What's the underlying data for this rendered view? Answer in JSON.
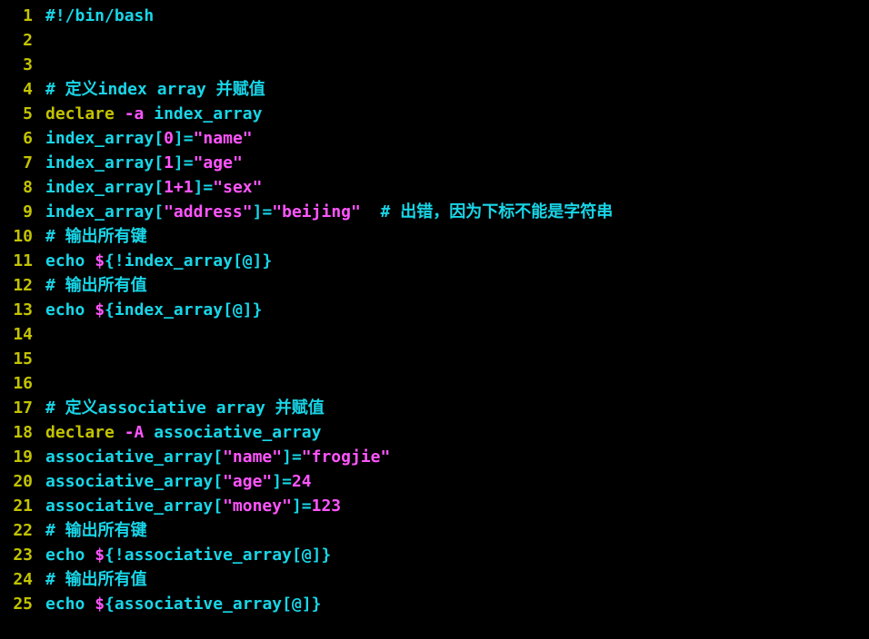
{
  "lines": [
    {
      "n": "1",
      "tokens": [
        {
          "t": "#!/bin/bash",
          "c": "c-comment"
        }
      ]
    },
    {
      "n": "2",
      "tokens": []
    },
    {
      "n": "3",
      "tokens": []
    },
    {
      "n": "4",
      "tokens": [
        {
          "t": "# 定义index array 并赋值",
          "c": "c-comment"
        }
      ]
    },
    {
      "n": "5",
      "tokens": [
        {
          "t": "declare",
          "c": "c-keyword"
        },
        {
          "t": " ",
          "c": "c-plain"
        },
        {
          "t": "-a",
          "c": "c-flag"
        },
        {
          "t": " ",
          "c": "c-plain"
        },
        {
          "t": "index_array",
          "c": "c-ident"
        }
      ]
    },
    {
      "n": "6",
      "tokens": [
        {
          "t": "index_array",
          "c": "c-var"
        },
        {
          "t": "[",
          "c": "c-bracket"
        },
        {
          "t": "0",
          "c": "c-num"
        },
        {
          "t": "]",
          "c": "c-bracket"
        },
        {
          "t": "=",
          "c": "c-eq"
        },
        {
          "t": "\"name\"",
          "c": "c-str"
        }
      ]
    },
    {
      "n": "7",
      "tokens": [
        {
          "t": "index_array",
          "c": "c-var"
        },
        {
          "t": "[",
          "c": "c-bracket"
        },
        {
          "t": "1",
          "c": "c-num"
        },
        {
          "t": "]",
          "c": "c-bracket"
        },
        {
          "t": "=",
          "c": "c-eq"
        },
        {
          "t": "\"age\"",
          "c": "c-str"
        }
      ]
    },
    {
      "n": "8",
      "tokens": [
        {
          "t": "index_array",
          "c": "c-var"
        },
        {
          "t": "[",
          "c": "c-bracket"
        },
        {
          "t": "1+1",
          "c": "c-num"
        },
        {
          "t": "]",
          "c": "c-bracket"
        },
        {
          "t": "=",
          "c": "c-eq"
        },
        {
          "t": "\"sex\"",
          "c": "c-str"
        }
      ]
    },
    {
      "n": "9",
      "tokens": [
        {
          "t": "index_array",
          "c": "c-var"
        },
        {
          "t": "[",
          "c": "c-bracket"
        },
        {
          "t": "\"address\"",
          "c": "c-str"
        },
        {
          "t": "]",
          "c": "c-bracket"
        },
        {
          "t": "=",
          "c": "c-eq"
        },
        {
          "t": "\"beijing\"",
          "c": "c-str"
        },
        {
          "t": "  ",
          "c": "c-plain"
        },
        {
          "t": "# 出错，因为下标不能是字符串",
          "c": "c-comment"
        }
      ]
    },
    {
      "n": "10",
      "tokens": [
        {
          "t": "# 输出所有键",
          "c": "c-comment"
        }
      ]
    },
    {
      "n": "11",
      "tokens": [
        {
          "t": "echo",
          "c": "c-echo"
        },
        {
          "t": " ",
          "c": "c-plain"
        },
        {
          "t": "$",
          "c": "c-dollar"
        },
        {
          "t": "{",
          "c": "c-brace"
        },
        {
          "t": "!index_array",
          "c": "c-var"
        },
        {
          "t": "[",
          "c": "c-bracket"
        },
        {
          "t": "@",
          "c": "c-at"
        },
        {
          "t": "]",
          "c": "c-bracket"
        },
        {
          "t": "}",
          "c": "c-brace"
        }
      ]
    },
    {
      "n": "12",
      "tokens": [
        {
          "t": "# 输出所有值",
          "c": "c-comment"
        }
      ]
    },
    {
      "n": "13",
      "tokens": [
        {
          "t": "echo",
          "c": "c-echo"
        },
        {
          "t": " ",
          "c": "c-plain"
        },
        {
          "t": "$",
          "c": "c-dollar"
        },
        {
          "t": "{",
          "c": "c-brace"
        },
        {
          "t": "index_array",
          "c": "c-var"
        },
        {
          "t": "[",
          "c": "c-bracket"
        },
        {
          "t": "@",
          "c": "c-at"
        },
        {
          "t": "]",
          "c": "c-bracket"
        },
        {
          "t": "}",
          "c": "c-brace"
        }
      ]
    },
    {
      "n": "14",
      "tokens": []
    },
    {
      "n": "15",
      "tokens": []
    },
    {
      "n": "16",
      "tokens": []
    },
    {
      "n": "17",
      "tokens": [
        {
          "t": "# 定义associative array 并赋值",
          "c": "c-comment"
        }
      ]
    },
    {
      "n": "18",
      "tokens": [
        {
          "t": "declare",
          "c": "c-keyword"
        },
        {
          "t": " ",
          "c": "c-plain"
        },
        {
          "t": "-A",
          "c": "c-flag"
        },
        {
          "t": " ",
          "c": "c-plain"
        },
        {
          "t": "associative_array",
          "c": "c-ident"
        }
      ]
    },
    {
      "n": "19",
      "tokens": [
        {
          "t": "associative_array",
          "c": "c-var"
        },
        {
          "t": "[",
          "c": "c-bracket"
        },
        {
          "t": "\"name\"",
          "c": "c-str"
        },
        {
          "t": "]",
          "c": "c-bracket"
        },
        {
          "t": "=",
          "c": "c-eq"
        },
        {
          "t": "\"frogjie\"",
          "c": "c-str"
        }
      ]
    },
    {
      "n": "20",
      "tokens": [
        {
          "t": "associative_array",
          "c": "c-var"
        },
        {
          "t": "[",
          "c": "c-bracket"
        },
        {
          "t": "\"age\"",
          "c": "c-str"
        },
        {
          "t": "]",
          "c": "c-bracket"
        },
        {
          "t": "=",
          "c": "c-eq"
        },
        {
          "t": "24",
          "c": "c-num"
        }
      ]
    },
    {
      "n": "21",
      "tokens": [
        {
          "t": "associative_array",
          "c": "c-var"
        },
        {
          "t": "[",
          "c": "c-bracket"
        },
        {
          "t": "\"money\"",
          "c": "c-str"
        },
        {
          "t": "]",
          "c": "c-bracket"
        },
        {
          "t": "=",
          "c": "c-eq"
        },
        {
          "t": "123",
          "c": "c-num"
        }
      ]
    },
    {
      "n": "22",
      "tokens": [
        {
          "t": "# 输出所有键",
          "c": "c-comment"
        }
      ]
    },
    {
      "n": "23",
      "tokens": [
        {
          "t": "echo",
          "c": "c-echo"
        },
        {
          "t": " ",
          "c": "c-plain"
        },
        {
          "t": "$",
          "c": "c-dollar"
        },
        {
          "t": "{",
          "c": "c-brace"
        },
        {
          "t": "!associative_array",
          "c": "c-var"
        },
        {
          "t": "[",
          "c": "c-bracket"
        },
        {
          "t": "@",
          "c": "c-at"
        },
        {
          "t": "]",
          "c": "c-bracket"
        },
        {
          "t": "}",
          "c": "c-brace"
        }
      ]
    },
    {
      "n": "24",
      "tokens": [
        {
          "t": "# 输出所有值",
          "c": "c-comment"
        }
      ]
    },
    {
      "n": "25",
      "tokens": [
        {
          "t": "echo",
          "c": "c-echo"
        },
        {
          "t": " ",
          "c": "c-plain"
        },
        {
          "t": "$",
          "c": "c-dollar"
        },
        {
          "t": "{",
          "c": "c-brace"
        },
        {
          "t": "associative_array",
          "c": "c-var"
        },
        {
          "t": "[",
          "c": "c-bracket"
        },
        {
          "t": "@",
          "c": "c-at"
        },
        {
          "t": "]",
          "c": "c-bracket"
        },
        {
          "t": "}",
          "c": "c-brace"
        }
      ]
    }
  ]
}
